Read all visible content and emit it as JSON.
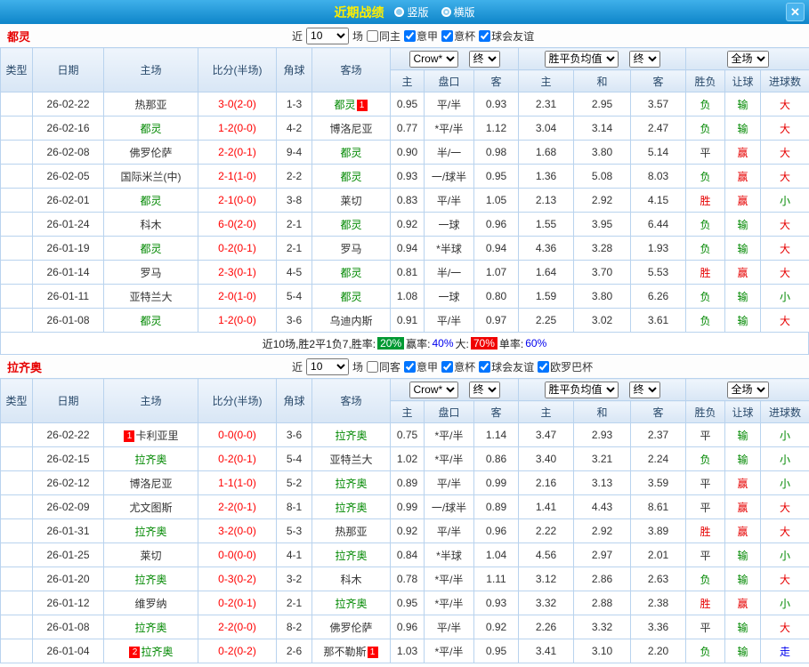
{
  "icons": {
    "close": "✕"
  },
  "titlebar": {
    "title": "近期战绩",
    "layout_options": [
      {
        "label": "竖版",
        "selected": false
      },
      {
        "label": "横版",
        "selected": true
      }
    ]
  },
  "filters": {
    "near": "近",
    "games": "场"
  },
  "table_header": {
    "type": "类型",
    "date": "日期",
    "home": "主场",
    "score": "比分(半场)",
    "corner": "角球",
    "away": "客场",
    "odds_select": "Crow*",
    "final_select": "终",
    "avg_select": "胜平负均值",
    "full_select": "全场",
    "sub": [
      "主",
      "盘口",
      "客",
      "主",
      "和",
      "客",
      "胜负",
      "让球",
      "进球数"
    ]
  },
  "colors": {
    "league_serie_a": "#2d8cf0",
    "league_cup": "#3a3ad0",
    "team_highlight": "#008800",
    "score_red": "#ff0000",
    "win_red": "#e60000",
    "lose_green": "#008800",
    "push_blue": "#0000ee"
  },
  "sections": [
    {
      "team": "都灵",
      "filter_count": "10",
      "checkboxes": [
        {
          "label": "同主",
          "checked": false
        },
        {
          "label": "意甲",
          "checked": true
        },
        {
          "label": "意杯",
          "checked": true
        },
        {
          "label": "球会友谊",
          "checked": true
        }
      ],
      "rows": [
        {
          "league": "意甲",
          "cup": false,
          "date": "26-02-22",
          "home": "热那亚",
          "home_green": false,
          "score": "3-0(2-0)",
          "corner": "1-3",
          "away": "都灵",
          "away_green": true,
          "away_post": "1",
          "o": [
            "0.95",
            "平/半",
            "0.93"
          ],
          "a": [
            "2.31",
            "2.95",
            "3.57"
          ],
          "res": [
            [
              "负",
              "g"
            ],
            [
              "输",
              "g"
            ],
            [
              "大",
              "r"
            ]
          ]
        },
        {
          "league": "意甲",
          "cup": false,
          "date": "26-02-16",
          "home": "都灵",
          "home_green": true,
          "score": "1-2(0-0)",
          "corner": "4-2",
          "away": "博洛尼亚",
          "o": [
            "0.77",
            "*平/半",
            "1.12"
          ],
          "a": [
            "3.04",
            "3.14",
            "2.47"
          ],
          "res": [
            [
              "负",
              "g"
            ],
            [
              "输",
              "g"
            ],
            [
              "大",
              "r"
            ]
          ]
        },
        {
          "league": "意甲",
          "cup": false,
          "date": "26-02-08",
          "home": "佛罗伦萨",
          "score": "2-2(0-1)",
          "corner": "9-4",
          "away": "都灵",
          "away_green": true,
          "o": [
            "0.90",
            "半/一",
            "0.98"
          ],
          "a": [
            "1.68",
            "3.80",
            "5.14"
          ],
          "res": [
            [
              "平",
              "k"
            ],
            [
              "赢",
              "r"
            ],
            [
              "大",
              "r"
            ]
          ]
        },
        {
          "league": "意杯",
          "cup": true,
          "date": "26-02-05",
          "home": "国际米兰(中)",
          "score": "2-1(1-0)",
          "corner": "2-2",
          "away": "都灵",
          "away_green": true,
          "o": [
            "0.93",
            "一/球半",
            "0.95"
          ],
          "a": [
            "1.36",
            "5.08",
            "8.03"
          ],
          "res": [
            [
              "负",
              "g"
            ],
            [
              "赢",
              "r"
            ],
            [
              "大",
              "r"
            ]
          ]
        },
        {
          "league": "意甲",
          "cup": false,
          "date": "26-02-01",
          "home": "都灵",
          "home_green": true,
          "score": "2-1(0-0)",
          "corner": "3-8",
          "away": "莱切",
          "o": [
            "0.83",
            "平/半",
            "1.05"
          ],
          "a": [
            "2.13",
            "2.92",
            "4.15"
          ],
          "res": [
            [
              "胜",
              "r"
            ],
            [
              "赢",
              "r"
            ],
            [
              "小",
              "g"
            ]
          ]
        },
        {
          "league": "意甲",
          "cup": false,
          "date": "26-01-24",
          "home": "科木",
          "score": "6-0(2-0)",
          "corner": "2-1",
          "away": "都灵",
          "away_green": true,
          "o": [
            "0.92",
            "一球",
            "0.96"
          ],
          "a": [
            "1.55",
            "3.95",
            "6.44"
          ],
          "res": [
            [
              "负",
              "g"
            ],
            [
              "输",
              "g"
            ],
            [
              "大",
              "r"
            ]
          ]
        },
        {
          "league": "意甲",
          "cup": false,
          "date": "26-01-19",
          "home": "都灵",
          "home_green": true,
          "score": "0-2(0-1)",
          "corner": "2-1",
          "away": "罗马",
          "o": [
            "0.94",
            "*半球",
            "0.94"
          ],
          "a": [
            "4.36",
            "3.28",
            "1.93"
          ],
          "res": [
            [
              "负",
              "g"
            ],
            [
              "输",
              "g"
            ],
            [
              "大",
              "r"
            ]
          ]
        },
        {
          "league": "意杯",
          "cup": true,
          "date": "26-01-14",
          "home": "罗马",
          "score": "2-3(0-1)",
          "corner": "4-5",
          "away": "都灵",
          "away_green": true,
          "o": [
            "0.81",
            "半/一",
            "1.07"
          ],
          "a": [
            "1.64",
            "3.70",
            "5.53"
          ],
          "res": [
            [
              "胜",
              "r"
            ],
            [
              "赢",
              "r"
            ],
            [
              "大",
              "r"
            ]
          ]
        },
        {
          "league": "意甲",
          "cup": false,
          "date": "26-01-11",
          "home": "亚特兰大",
          "score": "2-0(1-0)",
          "corner": "5-4",
          "away": "都灵",
          "away_green": true,
          "o": [
            "1.08",
            "一球",
            "0.80"
          ],
          "a": [
            "1.59",
            "3.80",
            "6.26"
          ],
          "res": [
            [
              "负",
              "g"
            ],
            [
              "输",
              "g"
            ],
            [
              "小",
              "g"
            ]
          ]
        },
        {
          "league": "意甲",
          "cup": false,
          "date": "26-01-08",
          "home": "都灵",
          "home_green": true,
          "score": "1-2(0-0)",
          "corner": "3-6",
          "away": "乌迪内斯",
          "o": [
            "0.91",
            "平/半",
            "0.97"
          ],
          "a": [
            "2.25",
            "3.02",
            "3.61"
          ],
          "res": [
            [
              "负",
              "g"
            ],
            [
              "输",
              "g"
            ],
            [
              "大",
              "r"
            ]
          ]
        }
      ],
      "summary": [
        {
          "text": "近10场,胜2平1负7,胜率: ",
          "style": "plain"
        },
        {
          "text": "20%",
          "style": "badge-green"
        },
        {
          "text": " 赢率:",
          "style": "plain"
        },
        {
          "text": "40%",
          "style": "blue"
        },
        {
          "text": " 大: ",
          "style": "plain"
        },
        {
          "text": "70%",
          "style": "badge-red"
        },
        {
          "text": " 单率:",
          "style": "plain"
        },
        {
          "text": "60%",
          "style": "blue"
        }
      ]
    },
    {
      "team": "拉齐奥",
      "filter_count": "10",
      "checkboxes": [
        {
          "label": "同客",
          "checked": false
        },
        {
          "label": "意甲",
          "checked": true
        },
        {
          "label": "意杯",
          "checked": true
        },
        {
          "label": "球会友谊",
          "checked": true
        },
        {
          "label": "欧罗巴杯",
          "checked": true
        }
      ],
      "rows": [
        {
          "league": "意甲",
          "cup": false,
          "date": "26-02-22",
          "home": "卡利亚里",
          "home_pre": "1",
          "score": "0-0(0-0)",
          "corner": "3-6",
          "away": "拉齐奥",
          "away_green": true,
          "o": [
            "0.75",
            "*平/半",
            "1.14"
          ],
          "a": [
            "3.47",
            "2.93",
            "2.37"
          ],
          "res": [
            [
              "平",
              "k"
            ],
            [
              "输",
              "g"
            ],
            [
              "小",
              "g"
            ]
          ]
        },
        {
          "league": "意甲",
          "cup": false,
          "date": "26-02-15",
          "home": "拉齐奥",
          "home_green": true,
          "score": "0-2(0-1)",
          "corner": "5-4",
          "away": "亚特兰大",
          "o": [
            "1.02",
            "*平/半",
            "0.86"
          ],
          "a": [
            "3.40",
            "3.21",
            "2.24"
          ],
          "res": [
            [
              "负",
              "g"
            ],
            [
              "输",
              "g"
            ],
            [
              "小",
              "g"
            ]
          ]
        },
        {
          "league": "意杯",
          "cup": true,
          "date": "26-02-12",
          "home": "博洛尼亚",
          "score": "1-1(1-0)",
          "corner": "5-2",
          "away": "拉齐奥",
          "away_green": true,
          "o": [
            "0.89",
            "平/半",
            "0.99"
          ],
          "a": [
            "2.16",
            "3.13",
            "3.59"
          ],
          "res": [
            [
              "平",
              "k"
            ],
            [
              "赢",
              "r"
            ],
            [
              "小",
              "g"
            ]
          ]
        },
        {
          "league": "意甲",
          "cup": false,
          "date": "26-02-09",
          "home": "尤文图斯",
          "score": "2-2(0-1)",
          "corner": "8-1",
          "away": "拉齐奥",
          "away_green": true,
          "o": [
            "0.99",
            "一/球半",
            "0.89"
          ],
          "a": [
            "1.41",
            "4.43",
            "8.61"
          ],
          "res": [
            [
              "平",
              "k"
            ],
            [
              "赢",
              "r"
            ],
            [
              "大",
              "r"
            ]
          ]
        },
        {
          "league": "意甲",
          "cup": false,
          "date": "26-01-31",
          "home": "拉齐奥",
          "home_green": true,
          "score": "3-2(0-0)",
          "corner": "5-3",
          "away": "热那亚",
          "o": [
            "0.92",
            "平/半",
            "0.96"
          ],
          "a": [
            "2.22",
            "2.92",
            "3.89"
          ],
          "res": [
            [
              "胜",
              "r"
            ],
            [
              "赢",
              "r"
            ],
            [
              "大",
              "r"
            ]
          ]
        },
        {
          "league": "意甲",
          "cup": false,
          "date": "26-01-25",
          "home": "莱切",
          "score": "0-0(0-0)",
          "corner": "4-1",
          "away": "拉齐奥",
          "away_green": true,
          "o": [
            "0.84",
            "*半球",
            "1.04"
          ],
          "a": [
            "4.56",
            "2.97",
            "2.01"
          ],
          "res": [
            [
              "平",
              "k"
            ],
            [
              "输",
              "g"
            ],
            [
              "小",
              "g"
            ]
          ]
        },
        {
          "league": "意甲",
          "cup": false,
          "date": "26-01-20",
          "home": "拉齐奥",
          "home_green": true,
          "score": "0-3(0-2)",
          "corner": "3-2",
          "away": "科木",
          "o": [
            "0.78",
            "*平/半",
            "1.11"
          ],
          "a": [
            "3.12",
            "2.86",
            "2.63"
          ],
          "res": [
            [
              "负",
              "g"
            ],
            [
              "输",
              "g"
            ],
            [
              "大",
              "r"
            ]
          ]
        },
        {
          "league": "意甲",
          "cup": false,
          "date": "26-01-12",
          "home": "维罗纳",
          "score": "0-2(0-1)",
          "corner": "2-1",
          "away": "拉齐奥",
          "away_green": true,
          "o": [
            "0.95",
            "*平/半",
            "0.93"
          ],
          "a": [
            "3.32",
            "2.88",
            "2.38"
          ],
          "res": [
            [
              "胜",
              "r"
            ],
            [
              "赢",
              "r"
            ],
            [
              "小",
              "g"
            ]
          ]
        },
        {
          "league": "意甲",
          "cup": false,
          "date": "26-01-08",
          "home": "拉齐奥",
          "home_green": true,
          "score": "2-2(0-0)",
          "corner": "8-2",
          "away": "佛罗伦萨",
          "o": [
            "0.96",
            "平/半",
            "0.92"
          ],
          "a": [
            "2.26",
            "3.32",
            "3.36"
          ],
          "res": [
            [
              "平",
              "k"
            ],
            [
              "输",
              "g"
            ],
            [
              "大",
              "r"
            ]
          ]
        },
        {
          "league": "意甲",
          "cup": false,
          "date": "26-01-04",
          "home": "拉齐奥",
          "home_green": true,
          "home_pre": "2",
          "score": "0-2(0-2)",
          "corner": "2-6",
          "away": "那不勒斯",
          "away_post": "1",
          "o": [
            "1.03",
            "*平/半",
            "0.95"
          ],
          "a": [
            "3.41",
            "3.10",
            "2.20"
          ],
          "res": [
            [
              "负",
              "g"
            ],
            [
              "输",
              "g"
            ],
            [
              "走",
              "b"
            ]
          ]
        }
      ]
    }
  ]
}
